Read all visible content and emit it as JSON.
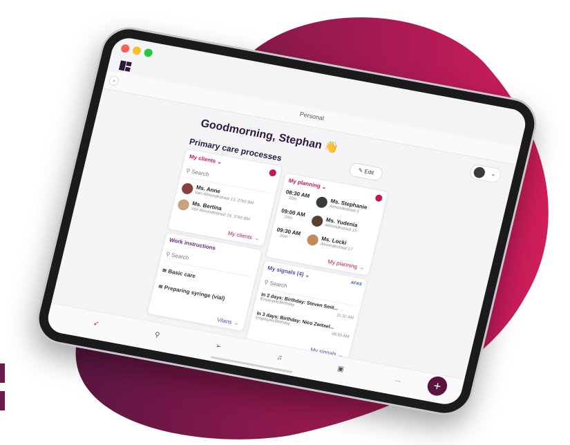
{
  "colors": {
    "blob_start": "#5a1642",
    "blob_end": "#d11d5c",
    "brand": "#c2185b",
    "dark": "#2a1b3d"
  },
  "app": {
    "page_title": "Personal",
    "greeting": "Goodmorning, Stephan 👋",
    "section": "Primary care processes",
    "edit_label": "✎ Edit"
  },
  "my_clients": {
    "title": "My clients ⌄",
    "search_placeholder": "Search",
    "clients": [
      {
        "name": "Ms. Anne",
        "address": "Van Almondestraat 13, 3760 BM"
      },
      {
        "name": "Ms. Bertina",
        "address": "Van Almondestraat 19, 3760 BM"
      }
    ],
    "link": "My clients →"
  },
  "my_planning": {
    "title": "My planning ⌄",
    "items": [
      {
        "time": "08:30 AM",
        "duration": "20m",
        "name": "Ms. Stephanie",
        "address": "Almondestraat 5"
      },
      {
        "time": "09:00 AM",
        "duration": "20m",
        "name": "Ms. Yudenia",
        "address": "Almondestraat 15"
      },
      {
        "time": "09:30 AM",
        "duration": "20m",
        "name": "Ms. Locki",
        "address": "Almondestraat 17"
      }
    ],
    "link": "My planning →"
  },
  "work_instructions": {
    "title": "Work instructions",
    "search_placeholder": "Search",
    "items": [
      "Basic care",
      "Preparing syringe (vial)"
    ],
    "link": "Vilans →"
  },
  "my_signals": {
    "title": "My signals (4) ⌄",
    "source": "AFAS",
    "search_placeholder": "Search",
    "items": [
      {
        "text": "In 2 days: Birthday: Steven Smit...",
        "type": "Employee/Birthday",
        "time": "11:32 AM"
      },
      {
        "text": "In 3 days: Birthday: Nico Zwitsel...",
        "type": "Employee/Birthday",
        "time": "08:55 AM"
      }
    ],
    "link": "My signals →"
  },
  "tabbar": {
    "more_label": "..."
  },
  "fab_label": "+"
}
